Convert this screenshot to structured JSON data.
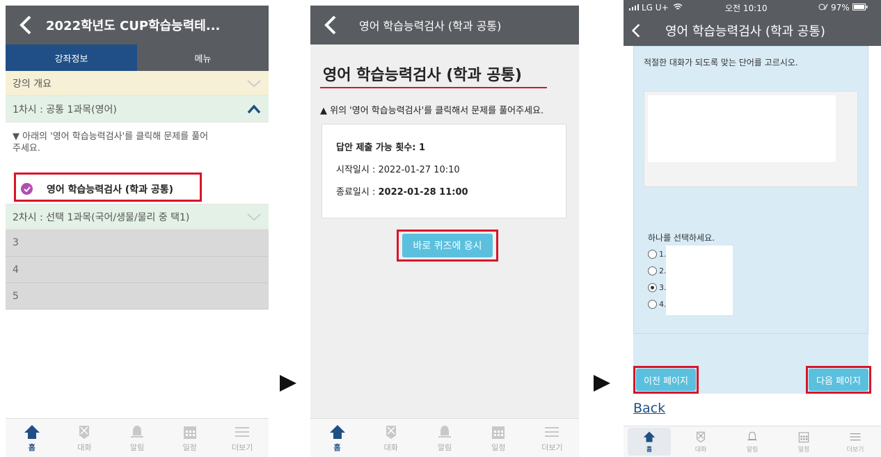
{
  "phone1": {
    "title": "2022학년도 CUP학습능력테...",
    "tabs": [
      "강좌정보",
      "메뉴"
    ],
    "overview": "강의 개요",
    "session1": "1차시 : 공통 1과목(영어)",
    "instruction": "▼ 아래의 '영어 학습능력검사'를 클릭해 문제를 풀어주세요.",
    "quiz_link": "영어 학습능력검사 (학과 공통)",
    "session2": "2차시 : 선택 1과목(국어/생물/물리 중 택1)",
    "sections": [
      "3",
      "4",
      "5"
    ]
  },
  "nav": [
    "홈",
    "대화",
    "알림",
    "일정",
    "더보기"
  ],
  "phone2": {
    "title": "영어 학습능력검사 (학과 공통)",
    "heading": "영어 학습능력검사 (학과 공통)",
    "instruction": "▲ 위의 '영어 학습능력검사'를 클릭해서 문제를 풀어주세요.",
    "attempts": "답안 제출 가능 횟수: 1",
    "start": "시작일시 : 2022-01-27 10:10",
    "end_label": "종료일시 : ",
    "end_value": "2022-01-28 11:00",
    "button": "바로 퀴즈에 응시"
  },
  "phone3": {
    "status_carrier": "LG U+",
    "status_time": "오전 10:10",
    "status_battery": "97%",
    "title": "영어 학습능력검사 (학과 공통)",
    "question": "적절한 대화가 되도록 맞는 단어를 고르시오.",
    "choose": "하나를 선택하세요.",
    "options": [
      "1.",
      "2.",
      "3.",
      "4."
    ],
    "selected_option": "3.",
    "prev": "이전 페이지",
    "next": "다음 페이지",
    "back_link": "Back"
  },
  "colors": {
    "accent": "#1f4f86",
    "header": "#595c61",
    "button": "#5bc0de",
    "highlight": "#d6162a",
    "quiz_icon": "#b04fb0"
  }
}
